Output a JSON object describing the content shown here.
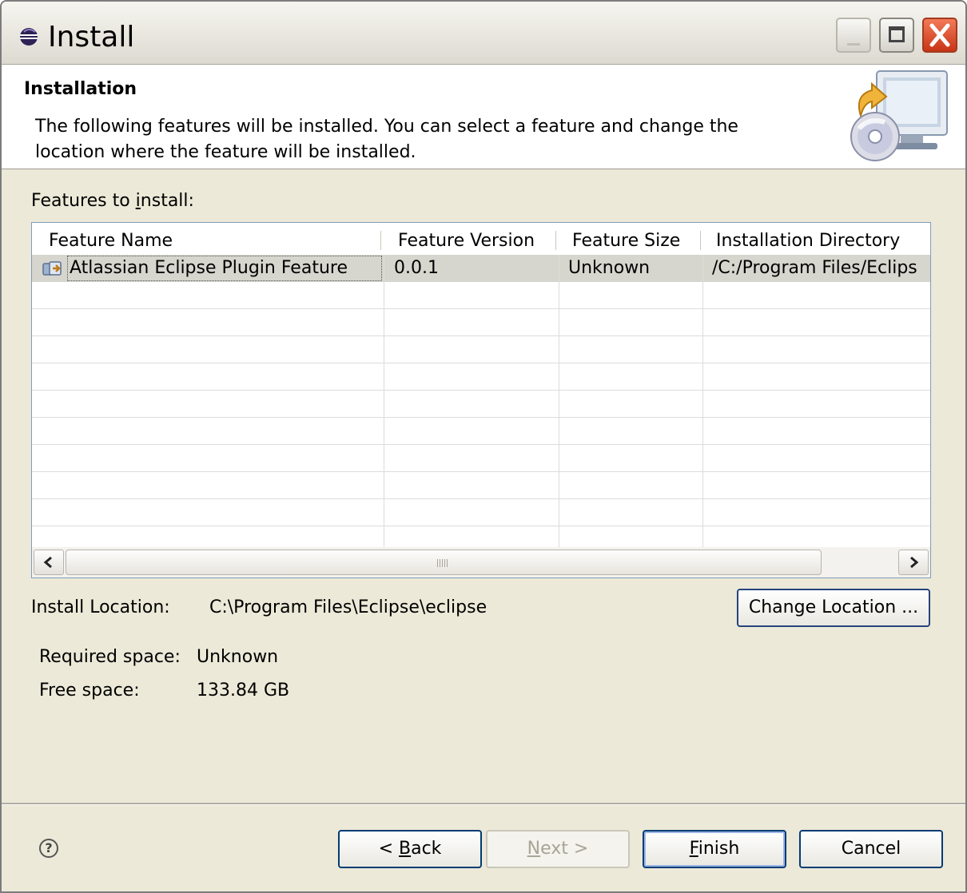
{
  "window": {
    "title": "Install",
    "controls": {
      "minimize": "minimize",
      "maximize": "maximize",
      "close": "close"
    }
  },
  "banner": {
    "title": "Installation",
    "description": "The following features will be installed. You can select a feature and change the location where the feature will be installed.",
    "icon": "install-computer-cd-icon"
  },
  "features": {
    "label_pre": "Features to ",
    "label_mnemonic": "i",
    "label_post": "nstall:",
    "columns": [
      "Feature Name",
      "Feature Version",
      "Feature Size",
      "Installation Directory"
    ],
    "rows": [
      {
        "name": "Atlassian Eclipse Plugin Feature",
        "version": "0.0.1",
        "size": "Unknown",
        "directory": "/C:/Program Files/Eclips",
        "selected": true
      }
    ]
  },
  "location": {
    "label": "Install Location:",
    "value": "C:\\Program Files\\Eclipse\\eclipse",
    "change_button": "Change Location ..."
  },
  "space": {
    "required_label": "Required space:",
    "required_value": "Unknown",
    "free_label": "Free space:",
    "free_value": "133.84 GB"
  },
  "footer": {
    "back": {
      "pre": "< ",
      "mnemonic": "B",
      "post": "ack"
    },
    "next": {
      "mnemonic": "N",
      "post": "ext >"
    },
    "finish": {
      "mnemonic": "F",
      "post": "inish"
    },
    "cancel": "Cancel",
    "help_icon": "help-icon"
  }
}
